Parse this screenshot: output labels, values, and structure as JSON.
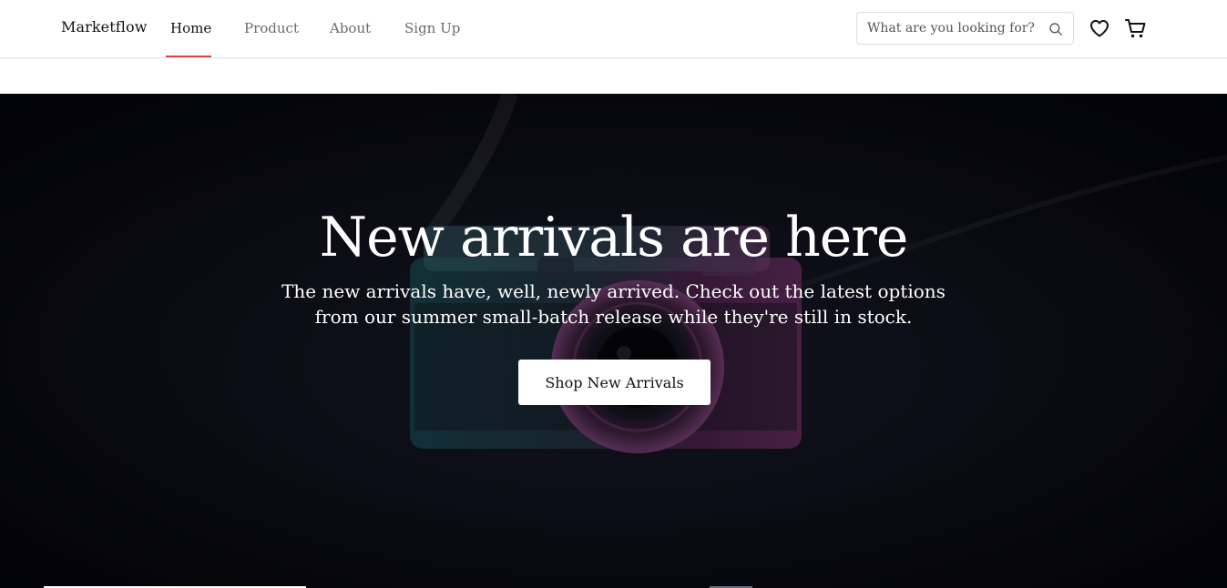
{
  "header": {
    "brand": "Marketflow",
    "nav": [
      {
        "label": "Home",
        "active": true
      },
      {
        "label": "Product",
        "active": false
      },
      {
        "label": "About",
        "active": false
      },
      {
        "label": "Sign Up",
        "active": false
      }
    ],
    "search": {
      "placeholder": "What are you looking for?",
      "value": ""
    },
    "accent_color": "#db4444"
  },
  "hero": {
    "title": "New arrivals are here",
    "subtitle": "The new arrivals have, well, newly arrived. Check out the latest options from our summer small-batch release while they're still in stock.",
    "cta_label": "Shop New Arrivals",
    "background_image": "camera-photo"
  },
  "icons": {
    "search": "search-icon",
    "wishlist": "heart-icon",
    "cart": "cart-icon"
  }
}
